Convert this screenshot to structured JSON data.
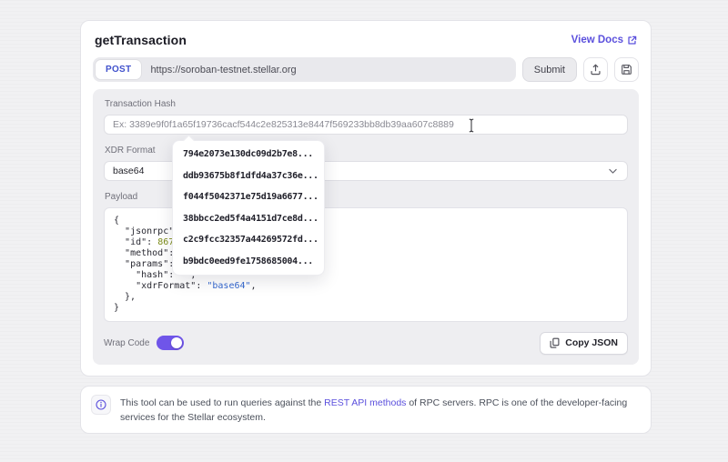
{
  "header": {
    "title": "getTransaction",
    "view_docs": "View Docs"
  },
  "request_bar": {
    "method": "POST",
    "url": "https://soroban-testnet.stellar.org",
    "submit": "Submit"
  },
  "form": {
    "transaction_hash": {
      "label": "Transaction Hash",
      "placeholder": "Ex: 3389e9f0f1a65f19736cacf544c2e825313e8447f569233bb8db39aa607c8889",
      "value": ""
    },
    "xdr_format": {
      "label": "XDR Format",
      "value": "base64"
    },
    "payload_label": "Payload"
  },
  "suggestions": {
    "items": [
      "794e2073e130dc09d2b7e8...",
      "ddb93675b8f1dfd4a37c36e...",
      "f044f5042371e75d19a6677...",
      "38bbcc2ed5f4a4151d7ce8d...",
      "c2c9fcc32357a44269572fd...",
      "b9bdc0eed9fe1758685004..."
    ]
  },
  "payload_code": {
    "lines": [
      [
        [
          "p",
          "{"
        ]
      ],
      [
        [
          "p",
          "  "
        ],
        [
          "k",
          "\"jsonrpc\""
        ],
        [
          "p",
          ":"
        ]
      ],
      [
        [
          "p",
          "  "
        ],
        [
          "k",
          "\"id\""
        ],
        [
          "p",
          ": "
        ],
        [
          "n",
          "86753"
        ]
      ],
      [
        [
          "p",
          "  "
        ],
        [
          "k",
          "\"method\""
        ],
        [
          "p",
          ": "
        ],
        [
          "s",
          "\""
        ]
      ],
      [
        [
          "p",
          "  "
        ],
        [
          "k",
          "\"params\""
        ],
        [
          "p",
          ": {"
        ]
      ],
      [
        [
          "p",
          "    "
        ],
        [
          "k",
          "\"hash\""
        ],
        [
          "p",
          ": "
        ],
        [
          "s",
          "\"\""
        ],
        [
          "p",
          ","
        ]
      ],
      [
        [
          "p",
          "    "
        ],
        [
          "k",
          "\"xdrFormat\""
        ],
        [
          "p",
          ": "
        ],
        [
          "s",
          "\"base64\""
        ],
        [
          "p",
          ","
        ]
      ],
      [
        [
          "p",
          "  },"
        ]
      ],
      [
        [
          "p",
          "}"
        ]
      ]
    ]
  },
  "panel_footer": {
    "wrap_code_label": "Wrap Code",
    "wrap_code_on": true,
    "copy_json": "Copy JSON"
  },
  "info_note": {
    "before": "This tool can be used to run queries against the ",
    "link": "REST API methods",
    "after": " of RPC servers. RPC is one of the developer-facing services for the Stellar ecosystem."
  },
  "icons": {
    "view_docs": "external-link-icon",
    "share": "share-icon",
    "save": "save-icon",
    "select": "chevron-down-icon",
    "copy": "copy-icon",
    "info": "info-icon",
    "mouse": "text-cursor-icon"
  },
  "colors": {
    "accent_purple": "#5b50dd",
    "toggle_purple": "#6f55e9",
    "post_method_blue": "#4152cc",
    "json_number_olive": "#7d8c1a",
    "json_string_blue": "#3468cf",
    "panel_gray": "#eeeef1",
    "page_background": "#f1f1f3"
  }
}
